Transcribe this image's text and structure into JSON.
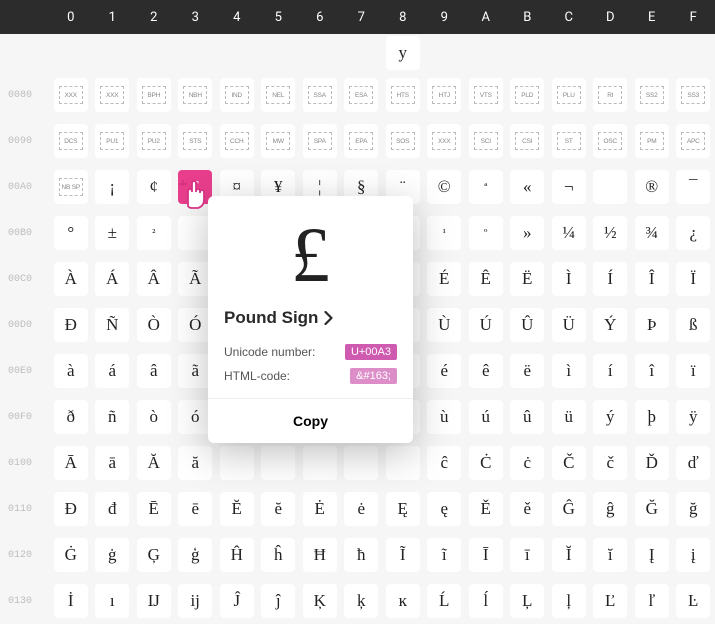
{
  "header": [
    "0",
    "1",
    "2",
    "3",
    "4",
    "5",
    "6",
    "7",
    "8",
    "9",
    "A",
    "B",
    "C",
    "D",
    "E",
    "F"
  ],
  "rows": [
    {
      "label": "",
      "partial": true,
      "cells": [
        {
          "t": "e"
        },
        {
          "t": "e"
        },
        {
          "t": "e"
        },
        {
          "t": "e"
        },
        {
          "t": "e"
        },
        {
          "t": "e"
        },
        {
          "t": "e"
        },
        {
          "t": "e"
        },
        {
          "t": "g",
          "v": "y"
        },
        {
          "t": "e"
        },
        {
          "t": "e"
        },
        {
          "t": "e"
        },
        {
          "t": "e"
        },
        {
          "t": "e"
        },
        {
          "t": "e"
        },
        {
          "t": "e"
        }
      ]
    },
    {
      "label": "0080",
      "cells": [
        {
          "t": "c",
          "v": "XXX"
        },
        {
          "t": "c",
          "v": "XXX"
        },
        {
          "t": "c",
          "v": "BPH"
        },
        {
          "t": "c",
          "v": "NBH"
        },
        {
          "t": "c",
          "v": "IND"
        },
        {
          "t": "c",
          "v": "NEL"
        },
        {
          "t": "c",
          "v": "SSA"
        },
        {
          "t": "c",
          "v": "ESA"
        },
        {
          "t": "c",
          "v": "HTS"
        },
        {
          "t": "c",
          "v": "HTJ"
        },
        {
          "t": "c",
          "v": "VTS"
        },
        {
          "t": "c",
          "v": "PLD"
        },
        {
          "t": "c",
          "v": "PLU"
        },
        {
          "t": "c",
          "v": "RI"
        },
        {
          "t": "c",
          "v": "SS2"
        },
        {
          "t": "c",
          "v": "SS3"
        }
      ]
    },
    {
      "label": "0090",
      "cells": [
        {
          "t": "c",
          "v": "DCS"
        },
        {
          "t": "c",
          "v": "PU1"
        },
        {
          "t": "c",
          "v": "PU2"
        },
        {
          "t": "c",
          "v": "STS"
        },
        {
          "t": "c",
          "v": "CCH"
        },
        {
          "t": "c",
          "v": "MW"
        },
        {
          "t": "c",
          "v": "SPA"
        },
        {
          "t": "c",
          "v": "EPA"
        },
        {
          "t": "c",
          "v": "SOS"
        },
        {
          "t": "c",
          "v": "XXX"
        },
        {
          "t": "c",
          "v": "SCI"
        },
        {
          "t": "c",
          "v": "CSI"
        },
        {
          "t": "c",
          "v": "ST"
        },
        {
          "t": "c",
          "v": "OSC"
        },
        {
          "t": "c",
          "v": "PM"
        },
        {
          "t": "c",
          "v": "APC"
        }
      ]
    },
    {
      "label": "00A0",
      "cells": [
        {
          "t": "c",
          "v": "NB SP"
        },
        {
          "t": "g",
          "v": "¡"
        },
        {
          "t": "g",
          "v": "¢"
        },
        {
          "t": "g",
          "v": "£",
          "selected": true
        },
        {
          "t": "g",
          "v": "¤"
        },
        {
          "t": "g",
          "v": "¥"
        },
        {
          "t": "g",
          "v": "¦"
        },
        {
          "t": "g",
          "v": "§"
        },
        {
          "t": "g",
          "v": "¨"
        },
        {
          "t": "g",
          "v": "©"
        },
        {
          "t": "g",
          "v": "ª",
          "sub": true
        },
        {
          "t": "g",
          "v": "«"
        },
        {
          "t": "g",
          "v": "¬"
        },
        {
          "t": "g",
          "v": ""
        },
        {
          "t": "g",
          "v": "®"
        },
        {
          "t": "g",
          "v": "¯"
        }
      ]
    },
    {
      "label": "00B0",
      "cells": [
        {
          "t": "g",
          "v": "°"
        },
        {
          "t": "g",
          "v": "±"
        },
        {
          "t": "g",
          "v": "²",
          "sub": true
        },
        {
          "t": "g",
          "v": ""
        },
        {
          "t": "g",
          "v": ""
        },
        {
          "t": "g",
          "v": ""
        },
        {
          "t": "g",
          "v": ""
        },
        {
          "t": "g",
          "v": ""
        },
        {
          "t": "g",
          "v": ""
        },
        {
          "t": "g",
          "v": "¹",
          "sub": true
        },
        {
          "t": "g",
          "v": "º",
          "sub": true
        },
        {
          "t": "g",
          "v": "»"
        },
        {
          "t": "g",
          "v": "¼"
        },
        {
          "t": "g",
          "v": "½"
        },
        {
          "t": "g",
          "v": "¾"
        },
        {
          "t": "g",
          "v": "¿"
        }
      ]
    },
    {
      "label": "00C0",
      "cells": [
        {
          "t": "g",
          "v": "À"
        },
        {
          "t": "g",
          "v": "Á"
        },
        {
          "t": "g",
          "v": "Â"
        },
        {
          "t": "g",
          "v": "Ã"
        },
        {
          "t": "g",
          "v": ""
        },
        {
          "t": "g",
          "v": ""
        },
        {
          "t": "g",
          "v": ""
        },
        {
          "t": "g",
          "v": ""
        },
        {
          "t": "g",
          "v": ""
        },
        {
          "t": "g",
          "v": "É"
        },
        {
          "t": "g",
          "v": "Ê"
        },
        {
          "t": "g",
          "v": "Ë"
        },
        {
          "t": "g",
          "v": "Ì"
        },
        {
          "t": "g",
          "v": "Í"
        },
        {
          "t": "g",
          "v": "Î"
        },
        {
          "t": "g",
          "v": "Ï"
        }
      ]
    },
    {
      "label": "00D0",
      "cells": [
        {
          "t": "g",
          "v": "Ð"
        },
        {
          "t": "g",
          "v": "Ñ"
        },
        {
          "t": "g",
          "v": "Ò"
        },
        {
          "t": "g",
          "v": "Ó"
        },
        {
          "t": "g",
          "v": ""
        },
        {
          "t": "g",
          "v": ""
        },
        {
          "t": "g",
          "v": ""
        },
        {
          "t": "g",
          "v": ""
        },
        {
          "t": "g",
          "v": ""
        },
        {
          "t": "g",
          "v": "Ù"
        },
        {
          "t": "g",
          "v": "Ú"
        },
        {
          "t": "g",
          "v": "Û"
        },
        {
          "t": "g",
          "v": "Ü"
        },
        {
          "t": "g",
          "v": "Ý"
        },
        {
          "t": "g",
          "v": "Þ"
        },
        {
          "t": "g",
          "v": "ß"
        }
      ]
    },
    {
      "label": "00E0",
      "cells": [
        {
          "t": "g",
          "v": "à"
        },
        {
          "t": "g",
          "v": "á"
        },
        {
          "t": "g",
          "v": "â"
        },
        {
          "t": "g",
          "v": "ã"
        },
        {
          "t": "g",
          "v": ""
        },
        {
          "t": "g",
          "v": ""
        },
        {
          "t": "g",
          "v": ""
        },
        {
          "t": "g",
          "v": ""
        },
        {
          "t": "g",
          "v": ""
        },
        {
          "t": "g",
          "v": "é"
        },
        {
          "t": "g",
          "v": "ê"
        },
        {
          "t": "g",
          "v": "ë"
        },
        {
          "t": "g",
          "v": "ì"
        },
        {
          "t": "g",
          "v": "í"
        },
        {
          "t": "g",
          "v": "î"
        },
        {
          "t": "g",
          "v": "ï"
        }
      ]
    },
    {
      "label": "00F0",
      "cells": [
        {
          "t": "g",
          "v": "ð"
        },
        {
          "t": "g",
          "v": "ñ"
        },
        {
          "t": "g",
          "v": "ò"
        },
        {
          "t": "g",
          "v": "ó"
        },
        {
          "t": "g",
          "v": ""
        },
        {
          "t": "g",
          "v": ""
        },
        {
          "t": "g",
          "v": ""
        },
        {
          "t": "g",
          "v": ""
        },
        {
          "t": "g",
          "v": ""
        },
        {
          "t": "g",
          "v": "ù"
        },
        {
          "t": "g",
          "v": "ú"
        },
        {
          "t": "g",
          "v": "û"
        },
        {
          "t": "g",
          "v": "ü"
        },
        {
          "t": "g",
          "v": "ý"
        },
        {
          "t": "g",
          "v": "þ"
        },
        {
          "t": "g",
          "v": "ÿ"
        }
      ]
    },
    {
      "label": "0100",
      "cells": [
        {
          "t": "g",
          "v": "Ā"
        },
        {
          "t": "g",
          "v": "ā"
        },
        {
          "t": "g",
          "v": "Ă"
        },
        {
          "t": "g",
          "v": "ă"
        },
        {
          "t": "g",
          "v": ""
        },
        {
          "t": "g",
          "v": ""
        },
        {
          "t": "g",
          "v": ""
        },
        {
          "t": "g",
          "v": ""
        },
        {
          "t": "g",
          "v": ""
        },
        {
          "t": "g",
          "v": "ĉ"
        },
        {
          "t": "g",
          "v": "Ċ"
        },
        {
          "t": "g",
          "v": "ċ"
        },
        {
          "t": "g",
          "v": "Č"
        },
        {
          "t": "g",
          "v": "č"
        },
        {
          "t": "g",
          "v": "Ď"
        },
        {
          "t": "g",
          "v": "ď"
        }
      ]
    },
    {
      "label": "0110",
      "cells": [
        {
          "t": "g",
          "v": "Đ"
        },
        {
          "t": "g",
          "v": "đ"
        },
        {
          "t": "g",
          "v": "Ē"
        },
        {
          "t": "g",
          "v": "ē"
        },
        {
          "t": "g",
          "v": "Ĕ"
        },
        {
          "t": "g",
          "v": "ĕ"
        },
        {
          "t": "g",
          "v": "Ė"
        },
        {
          "t": "g",
          "v": "ė"
        },
        {
          "t": "g",
          "v": "Ę"
        },
        {
          "t": "g",
          "v": "ę"
        },
        {
          "t": "g",
          "v": "Ě"
        },
        {
          "t": "g",
          "v": "ě"
        },
        {
          "t": "g",
          "v": "Ĝ"
        },
        {
          "t": "g",
          "v": "ĝ"
        },
        {
          "t": "g",
          "v": "Ğ"
        },
        {
          "t": "g",
          "v": "ğ"
        }
      ]
    },
    {
      "label": "0120",
      "cells": [
        {
          "t": "g",
          "v": "Ġ"
        },
        {
          "t": "g",
          "v": "ġ"
        },
        {
          "t": "g",
          "v": "Ģ"
        },
        {
          "t": "g",
          "v": "ģ"
        },
        {
          "t": "g",
          "v": "Ĥ"
        },
        {
          "t": "g",
          "v": "ĥ"
        },
        {
          "t": "g",
          "v": "Ħ"
        },
        {
          "t": "g",
          "v": "ħ"
        },
        {
          "t": "g",
          "v": "Ĩ"
        },
        {
          "t": "g",
          "v": "ĩ"
        },
        {
          "t": "g",
          "v": "Ī"
        },
        {
          "t": "g",
          "v": "ī"
        },
        {
          "t": "g",
          "v": "Ĭ"
        },
        {
          "t": "g",
          "v": "ĭ"
        },
        {
          "t": "g",
          "v": "Į"
        },
        {
          "t": "g",
          "v": "į"
        }
      ]
    },
    {
      "label": "0130",
      "cells": [
        {
          "t": "g",
          "v": "İ"
        },
        {
          "t": "g",
          "v": "ı"
        },
        {
          "t": "g",
          "v": "Ĳ"
        },
        {
          "t": "g",
          "v": "ĳ"
        },
        {
          "t": "g",
          "v": "Ĵ"
        },
        {
          "t": "g",
          "v": "ĵ"
        },
        {
          "t": "g",
          "v": "Ķ"
        },
        {
          "t": "g",
          "v": "ķ"
        },
        {
          "t": "g",
          "v": "ĸ"
        },
        {
          "t": "g",
          "v": "Ĺ"
        },
        {
          "t": "g",
          "v": "ĺ"
        },
        {
          "t": "g",
          "v": "Ļ"
        },
        {
          "t": "g",
          "v": "ļ"
        },
        {
          "t": "g",
          "v": "Ľ"
        },
        {
          "t": "g",
          "v": "ľ"
        },
        {
          "t": "g",
          "v": "Ŀ"
        }
      ]
    }
  ],
  "popup": {
    "glyph": "£",
    "title": "Pound Sign",
    "unicode_label": "Unicode number:",
    "unicode_value": "U+00A3",
    "html_label": "HTML-code:",
    "html_value": "&#163;",
    "copy": "Copy"
  }
}
